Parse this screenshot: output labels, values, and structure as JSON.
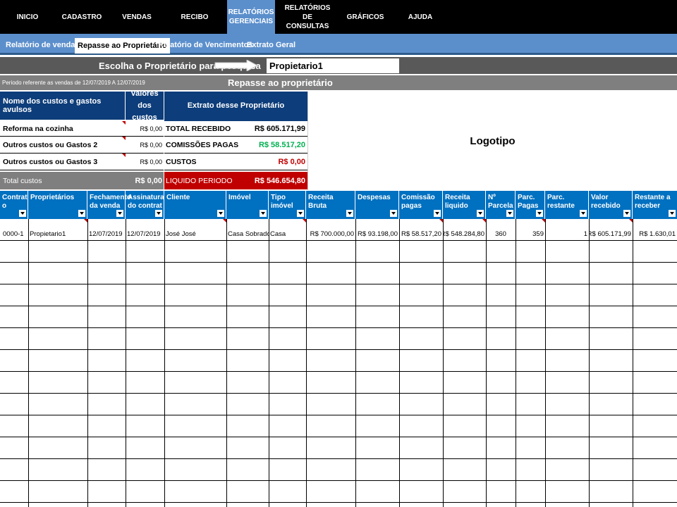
{
  "menu": [
    {
      "label": "INICIO",
      "active": false
    },
    {
      "label": "CADASTRO",
      "active": false
    },
    {
      "label": "VENDAS",
      "active": false
    },
    {
      "label": "RECIBO",
      "active": false
    },
    {
      "label": "RELATÓRIOS GERENCIAIS",
      "active": true
    },
    {
      "label": "RELATÓRIOS DE CONSULTAS",
      "active": false
    },
    {
      "label": "GRÁFICOS",
      "active": false
    },
    {
      "label": "AJUDA",
      "active": false
    }
  ],
  "subtabs": [
    {
      "label": "Relatório de vendas",
      "active": false
    },
    {
      "label": "Repasse ao Proprietário",
      "active": true
    },
    {
      "label": "Relatório de Vencimentos",
      "active": false
    },
    {
      "label": "Extrato Geral",
      "active": false
    }
  ],
  "search": {
    "label": "Escolha o Proprietário para pesquisa",
    "value": "Propietario1"
  },
  "period": {
    "text": "Periodo referente as vendas de 12/07/2019 A 12/07/2019",
    "title": "Repasse ao proprietário"
  },
  "costs": {
    "header_name": "Nome dos custos e gastos avulsos",
    "header_value": "Valores dos custos",
    "items": [
      {
        "name": "Reforma na cozinha",
        "value": "R$ 0,00"
      },
      {
        "name": "Outros custos ou Gastos 2",
        "value": "R$ 0,00"
      },
      {
        "name": "Outros custos ou Gastos 3",
        "value": "R$ 0,00"
      }
    ],
    "total_label": "Total custos",
    "total_value": "R$ 0,00"
  },
  "extract": {
    "header": "Extrato desse Proprietário",
    "total_recebido_label": "TOTAL RECEBIDO",
    "total_recebido_value": "R$ 605.171,99",
    "comissoes_label": "COMISSÕES PAGAS",
    "comissoes_value": "R$ 58.517,20",
    "custos_label": "CUSTOS",
    "custos_value": "R$ 0,00",
    "liquido_label": "LIQUIDO PERIODO",
    "liquido_value": "R$ 546.654,80"
  },
  "logo_text": "Logotipo",
  "table": {
    "headers": [
      "Contrat o",
      "Proprietários",
      "Fechamento da venda",
      "Assinatura do contrat",
      "Cliente",
      "Imóvel",
      "Tipo imóvel",
      "Receita Bruta",
      "Despesas",
      "Comissão pagas",
      "Receita liquido",
      "Nº Parcela",
      "Parc. Pagas",
      "Parc. restante",
      "Valor recebido",
      "Restante a receber"
    ],
    "rows": [
      [
        "0000-1",
        "Propietario1",
        "12/07/2019",
        "12/07/2019",
        "José José",
        "Casa Sobrado",
        "Casa",
        "R$ 700.000,00",
        "R$ 93.198,00",
        "R$ 58.517,20",
        "R$ 548.284,80",
        "360",
        "359",
        "1",
        "R$ 605.171,99",
        "R$ 1.630,01"
      ]
    ]
  },
  "colors": {
    "menu_bg": "#000000",
    "accent_blue": "#5b8fcc",
    "header_dark_blue": "#0d3d7a",
    "table_header_blue": "#0070c0",
    "green_value": "#00b050",
    "red_value": "#c00000",
    "liquido_bg": "#c00000"
  }
}
